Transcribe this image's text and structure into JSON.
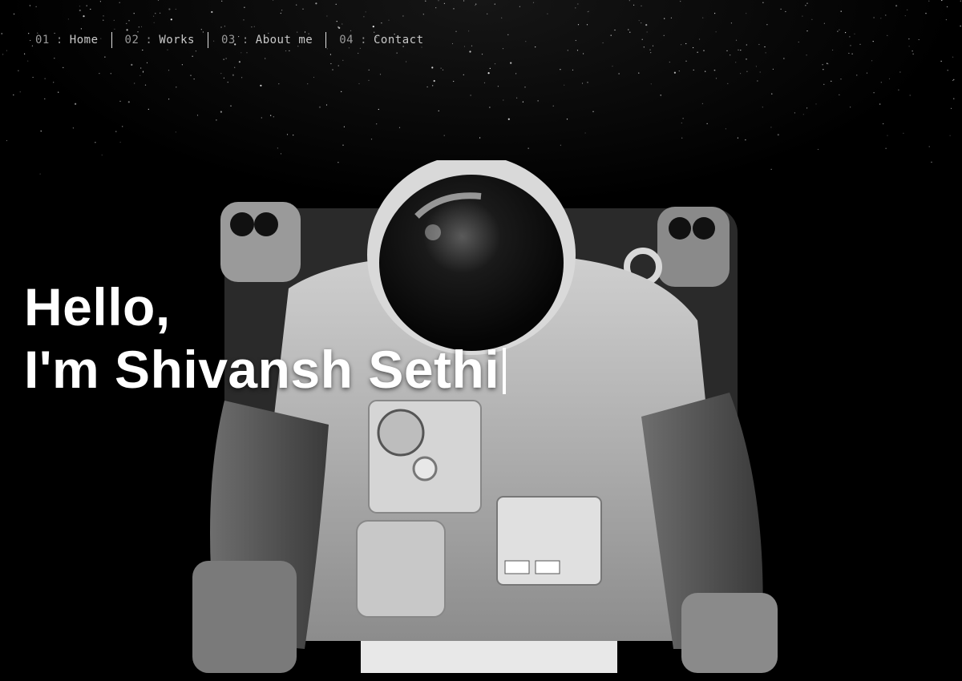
{
  "nav": {
    "items": [
      {
        "num": "01",
        "sep": ":",
        "label": "Home"
      },
      {
        "num": "02",
        "sep": ":",
        "label": "Works"
      },
      {
        "num": "03",
        "sep": ":",
        "label": "About me"
      },
      {
        "num": "04",
        "sep": ":",
        "label": "Contact"
      }
    ]
  },
  "hero": {
    "line1": "Hello,",
    "line2": "I'm Shivansh Sethi",
    "cursor_glyph": "|"
  },
  "colors": {
    "background": "#000000",
    "text": "#ffffff",
    "nav_text": "#c9c9c9"
  },
  "image": {
    "subject_icon": "astronaut-illustration"
  }
}
